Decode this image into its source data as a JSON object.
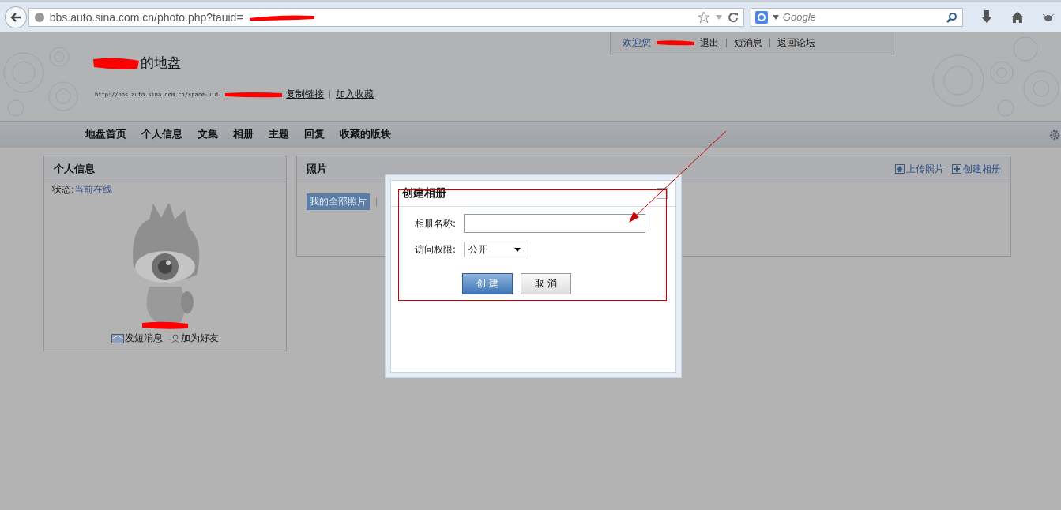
{
  "browser": {
    "url": "bbs.auto.sina.com.cn/photo.php?tauid=",
    "search_placeholder": "Google"
  },
  "user_bar": {
    "greeting": "欢迎您",
    "links": [
      "退出",
      "短消息",
      "返回论坛"
    ]
  },
  "space": {
    "title": "的地盘",
    "url": "http://bbs.auto.sina.com.cn/space-uid-",
    "links": [
      "复制链接",
      "加入收藏"
    ]
  },
  "nav": [
    {
      "label": "地盘首页"
    },
    {
      "label": "个人信息"
    },
    {
      "label": "文集"
    },
    {
      "label": "相册"
    },
    {
      "label": "主题"
    },
    {
      "label": "回复"
    },
    {
      "label": "收藏的版块"
    }
  ],
  "profile": {
    "title": "个人信息",
    "status_label": "状态:",
    "status": "当前在线",
    "actions": [
      {
        "kind": "message",
        "label": "发短消息"
      },
      {
        "kind": "friend",
        "label": "加为好友"
      }
    ]
  },
  "photos": {
    "title": "照片",
    "actions": [
      {
        "kind": "upload",
        "label": "上传照片"
      },
      {
        "kind": "create",
        "label": "创建相册"
      }
    ],
    "filters": [
      {
        "label": "我的全部照片",
        "selected": true
      }
    ]
  },
  "dialog": {
    "title": "创建相册",
    "fields": [
      {
        "kind": "text",
        "label": "相册名称:"
      },
      {
        "kind": "select",
        "label": "访问权限:",
        "value": "公开"
      }
    ],
    "buttons": [
      {
        "label": "创 建",
        "primary": true
      },
      {
        "label": "取 消",
        "primary": false
      }
    ]
  }
}
